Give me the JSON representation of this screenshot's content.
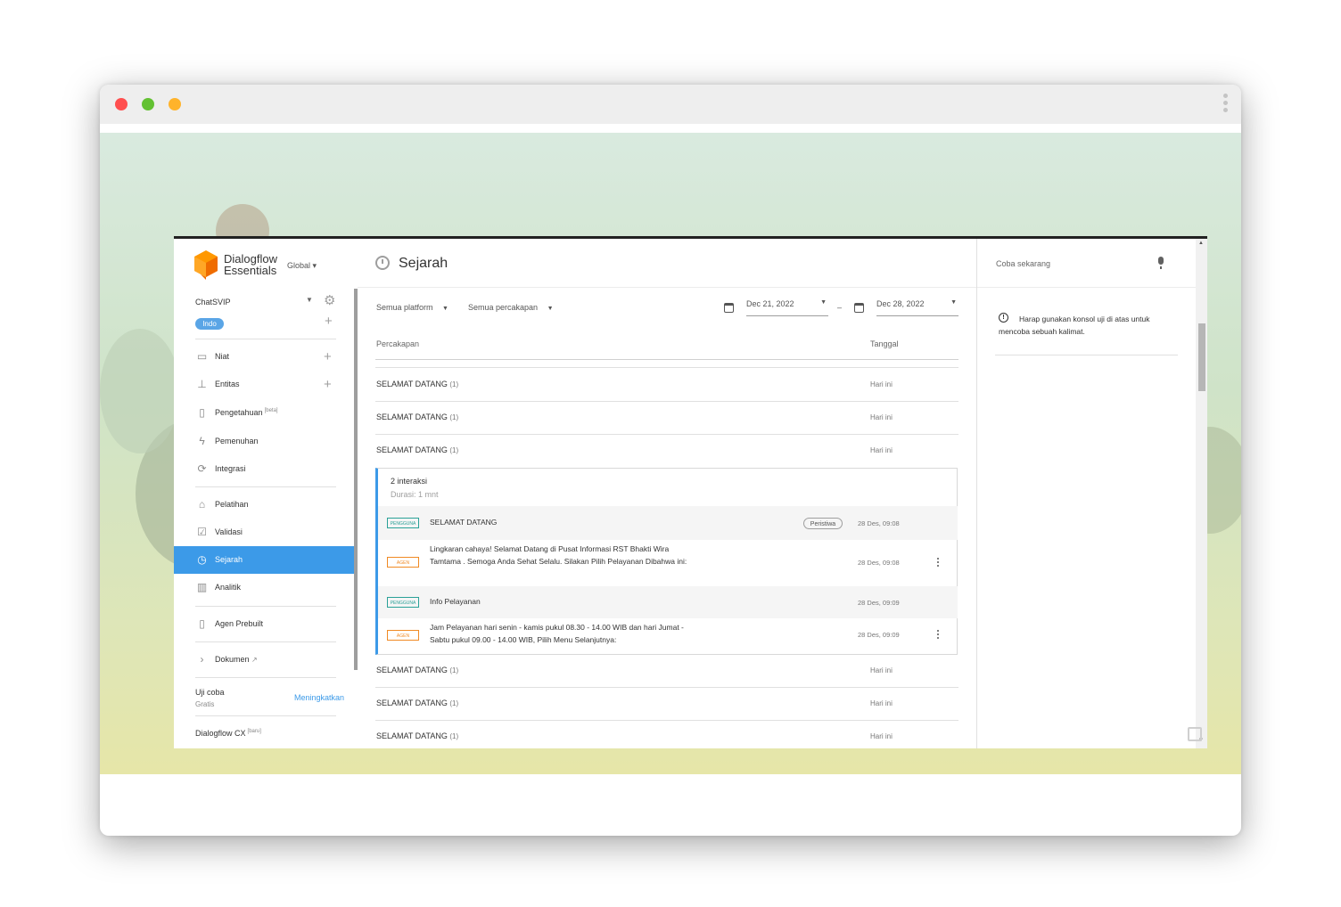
{
  "browser": {
    "dots": [
      "#ff4f4f",
      "#63c132",
      "#ffb32b"
    ]
  },
  "sidebar": {
    "logo_line1": "Dialogflow",
    "logo_line2": "Essentials",
    "region": "Global",
    "agent": "ChatSVIP",
    "language": "Indo",
    "items": [
      {
        "label": "Niat",
        "icon": "chat-bubble-icon",
        "has_add": true
      },
      {
        "label": "Entitas",
        "icon": "hierarchy-icon",
        "has_add": true
      },
      {
        "label": "Pengetahuan",
        "sup": "[beta]",
        "icon": "book-icon"
      },
      {
        "label": "Pemenuhan",
        "icon": "lightning-icon"
      },
      {
        "label": "Integrasi",
        "icon": "sync-icon"
      },
      {
        "label": "Pelatihan",
        "icon": "graduation-cap-icon"
      },
      {
        "label": "Validasi",
        "icon": "checkbox-icon"
      },
      {
        "label": "Sejarah",
        "icon": "clock-icon",
        "active": true
      },
      {
        "label": "Analitik",
        "icon": "bar-chart-icon"
      },
      {
        "label": "Agen Prebuilt",
        "icon": "bookmark-icon"
      },
      {
        "label": "Dokumen",
        "icon": "chevron-right-icon"
      }
    ],
    "plan_title": "Uji coba",
    "plan_sub": "Gratis",
    "upgrade": "Meningkatkan",
    "cx_label": "Dialogflow CX",
    "cx_sup": "[baru]"
  },
  "main": {
    "title": "Sejarah",
    "filter_platform": "Semua platform",
    "filter_conversations": "Semua percakapan",
    "date_from": "Dec 21, 2022",
    "date_to": "Dec 28, 2022",
    "date_sep": "–",
    "col_conversation": "Percakapan",
    "col_date": "Tanggal",
    "rows_top": [
      {
        "title": "SELAMAT DATANG",
        "count": "(1)",
        "date": "Hari ini"
      },
      {
        "title": "SELAMAT DATANG",
        "count": "(1)",
        "date": "Hari ini"
      },
      {
        "title": "SELAMAT DATANG",
        "count": "(1)",
        "date": "Hari ini"
      }
    ],
    "detail": {
      "interactions": "2 interaksi",
      "duration": "Durasi: 1 mnt",
      "messages": [
        {
          "role": "PENGGUNA",
          "text": "SELAMAT DATANG",
          "pill": "Peristiwa",
          "date": "28 Des, 09:08"
        },
        {
          "role": "AGEN",
          "text": "Lingkaran cahaya! Selamat Datang di Pusat Informasi RST Bhakti Wira Tamtama . Semoga Anda Sehat Selalu. Silakan Pilih Pelayanan Dibahwa ini:",
          "date": "28 Des, 09:08"
        },
        {
          "role": "PENGGUNA",
          "text": "Info Pelayanan",
          "date": "28 Des, 09:09"
        },
        {
          "role": "AGEN",
          "text": "Jam Pelayanan hari senin - kamis pukul 08.30 - 14.00 WIB dan hari Jumat - Sabtu pukul 09.00 - 14.00 WIB, Pilih Menu Selanjutnya:",
          "date": "28 Des, 09:09"
        }
      ]
    },
    "rows_bottom": [
      {
        "title": "SELAMAT DATANG",
        "count": "(1)",
        "date": "Hari ini"
      },
      {
        "title": "SELAMAT DATANG",
        "count": "(1)",
        "date": "Hari ini"
      },
      {
        "title": "SELAMAT DATANG",
        "count": "(1)",
        "date": "Hari ini"
      }
    ]
  },
  "right": {
    "try_placeholder": "Coba sekarang",
    "info": "Harap gunakan konsol uji di atas untuk mencoba sebuah kalimat."
  }
}
